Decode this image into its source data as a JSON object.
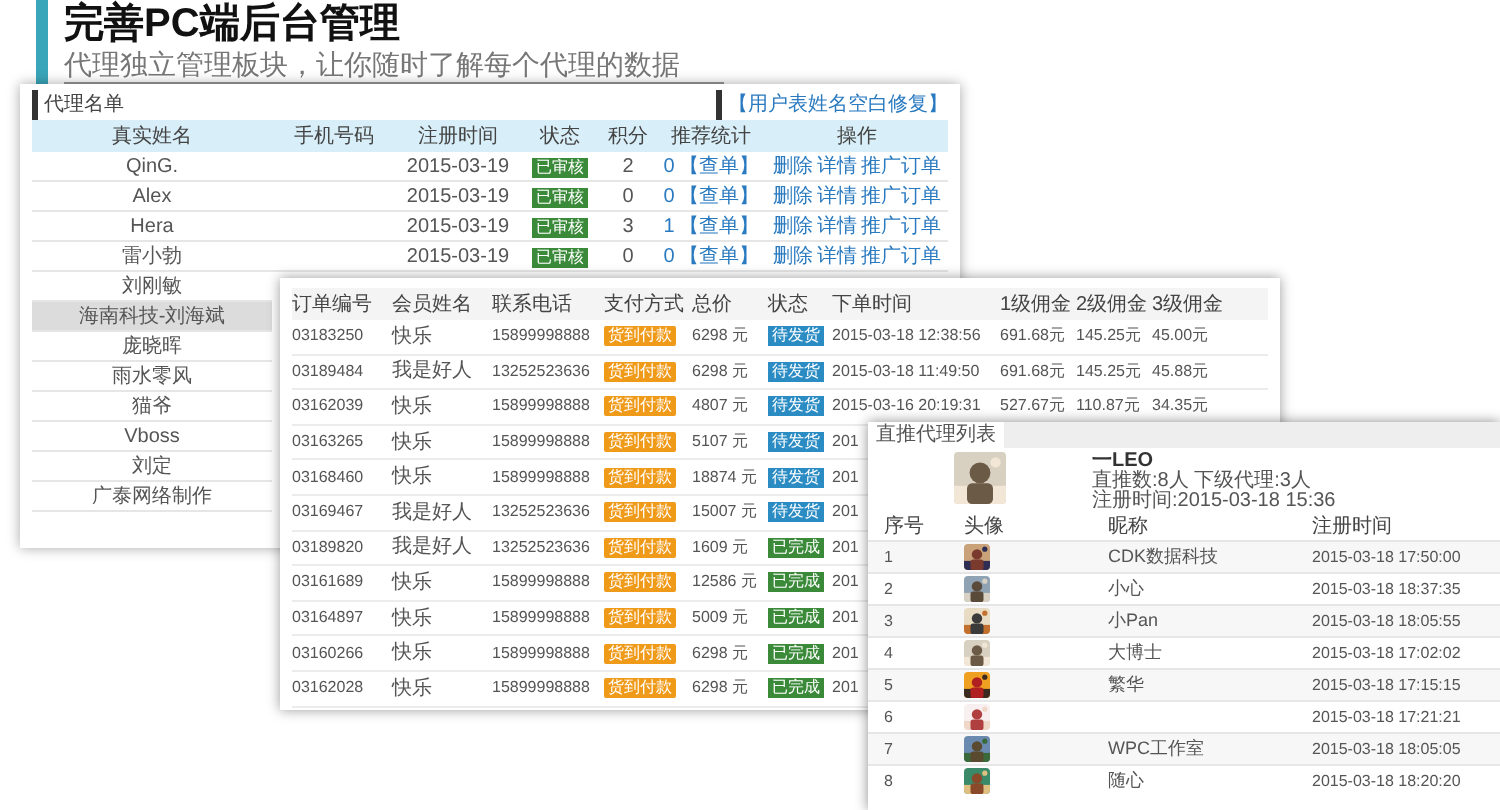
{
  "heading": {
    "title": "完善PC端后台管理",
    "subtitle": "代理独立管理板块，让你随时了解每个代理的数据"
  },
  "agents": {
    "title": "代理名单",
    "action": "【用户表姓名空白修复】",
    "columns": [
      "真实姓名",
      "手机号码",
      "注册时间",
      "状态",
      "积分",
      "推荐统计",
      "操作"
    ],
    "rows": [
      {
        "name": "QinG.",
        "date": "2015-03-19",
        "status": "已审核",
        "points": "2",
        "count": "0",
        "count_link": "【查单】",
        "ops": [
          "删除",
          "详情",
          "推广订单"
        ],
        "selected": false
      },
      {
        "name": "Alex",
        "date": "2015-03-19",
        "status": "已审核",
        "points": "0",
        "count": "0",
        "count_link": "【查单】",
        "ops": [
          "删除",
          "详情",
          "推广订单"
        ],
        "selected": false
      },
      {
        "name": "Hera",
        "date": "2015-03-19",
        "status": "已审核",
        "points": "3",
        "count": "1",
        "count_link": "【查单】",
        "ops": [
          "删除",
          "详情",
          "推广订单"
        ],
        "selected": false
      },
      {
        "name": "雷小勃",
        "date": "2015-03-19",
        "status": "已审核",
        "points": "0",
        "count": "0",
        "count_link": "【查单】",
        "ops": [
          "删除",
          "详情",
          "推广订单"
        ],
        "selected": false
      },
      {
        "name": "刘刚敏",
        "selected": false
      },
      {
        "name": "海南科技-刘海斌",
        "selected": true
      },
      {
        "name": "庞晓晖",
        "selected": false
      },
      {
        "name": "雨水零风",
        "selected": false
      },
      {
        "name": "猫爷",
        "selected": false
      },
      {
        "name": "Vboss",
        "selected": false
      },
      {
        "name": "刘定",
        "selected": false
      },
      {
        "name": "广泰网络制作",
        "selected": false
      }
    ]
  },
  "orders": {
    "columns": [
      "订单编号",
      "会员姓名",
      "联系电话",
      "支付方式",
      "总价",
      "状态",
      "下单时间",
      "1级佣金",
      "2级佣金",
      "3级佣金"
    ],
    "rows": [
      {
        "id": "03183250",
        "member": "快乐",
        "phone": "15899998888",
        "payment": "货到付款",
        "total": "6298 元",
        "status": {
          "text": "待发货",
          "color": "#2b8cc4"
        },
        "time": "2015-03-18 12:38:56",
        "c1": "691.68元",
        "c2": "145.25元",
        "c3": "45.00元"
      },
      {
        "id": "03189484",
        "member": "我是好人",
        "phone": "13252523636",
        "payment": "货到付款",
        "total": "6298 元",
        "status": {
          "text": "待发货",
          "color": "#2b8cc4"
        },
        "time": "2015-03-18 11:49:50",
        "c1": "691.68元",
        "c2": "145.25元",
        "c3": "45.88元"
      },
      {
        "id": "03162039",
        "member": "快乐",
        "phone": "15899998888",
        "payment": "货到付款",
        "total": "4807 元",
        "status": {
          "text": "待发货",
          "color": "#2b8cc4"
        },
        "time": "2015-03-16 20:19:31",
        "c1": "527.67元",
        "c2": "110.87元",
        "c3": "34.35元"
      },
      {
        "id": "03163265",
        "member": "快乐",
        "phone": "15899998888",
        "payment": "货到付款",
        "total": "5107 元",
        "status": {
          "text": "待发货",
          "color": "#2b8cc4"
        },
        "time": "201"
      },
      {
        "id": "03168460",
        "member": "快乐",
        "phone": "15899998888",
        "payment": "货到付款",
        "total": "18874 元",
        "status": {
          "text": "待发货",
          "color": "#2b8cc4"
        },
        "time": "201"
      },
      {
        "id": "03169467",
        "member": "我是好人",
        "phone": "13252523636",
        "payment": "货到付款",
        "total": "15007 元",
        "status": {
          "text": "待发货",
          "color": "#2b8cc4"
        },
        "time": "201"
      },
      {
        "id": "03189820",
        "member": "我是好人",
        "phone": "13252523636",
        "payment": "货到付款",
        "total": "1609 元",
        "status": {
          "text": "已完成",
          "color": "#3a8a3a"
        },
        "time": "201"
      },
      {
        "id": "03161689",
        "member": "快乐",
        "phone": "15899998888",
        "payment": "货到付款",
        "total": "12586 元",
        "status": {
          "text": "已完成",
          "color": "#3a8a3a"
        },
        "time": "201"
      },
      {
        "id": "03164897",
        "member": "快乐",
        "phone": "15899998888",
        "payment": "货到付款",
        "total": "5009 元",
        "status": {
          "text": "已完成",
          "color": "#3a8a3a"
        },
        "time": "201"
      },
      {
        "id": "03160266",
        "member": "快乐",
        "phone": "15899998888",
        "payment": "货到付款",
        "total": "6298 元",
        "status": {
          "text": "已完成",
          "color": "#3a8a3a"
        },
        "time": "201"
      },
      {
        "id": "03162028",
        "member": "快乐",
        "phone": "15899998888",
        "payment": "货到付款",
        "total": "6298 元",
        "status": {
          "text": "已完成",
          "color": "#3a8a3a"
        },
        "time": "201"
      }
    ]
  },
  "referrals": {
    "tab": "直推代理列表",
    "name": "一LEO",
    "stats": "直推数:8人  下级代理:3人",
    "registered": "注册时间:2015-03-18 15:36",
    "columns": [
      "序号",
      "头像",
      "昵称",
      "注册时间"
    ],
    "rows": [
      {
        "no": "1",
        "nickname": "CDK数据科技",
        "time": "2015-03-18 17:50:00"
      },
      {
        "no": "2",
        "nickname": "小心",
        "time": "2015-03-18 18:37:35"
      },
      {
        "no": "3",
        "nickname": "小Pan",
        "time": "2015-03-18 18:05:55"
      },
      {
        "no": "4",
        "nickname": "大博士",
        "time": "2015-03-18 17:02:02"
      },
      {
        "no": "5",
        "nickname": "繁华",
        "time": "2015-03-18 17:15:15"
      },
      {
        "no": "6",
        "time": "2015-03-18 17:21:21"
      },
      {
        "no": "7",
        "nickname": "WPC工作室",
        "time": "2015-03-18 18:05:05"
      },
      {
        "no": "8",
        "nickname": "随心",
        "time": "2015-03-18 18:20:20"
      }
    ]
  }
}
